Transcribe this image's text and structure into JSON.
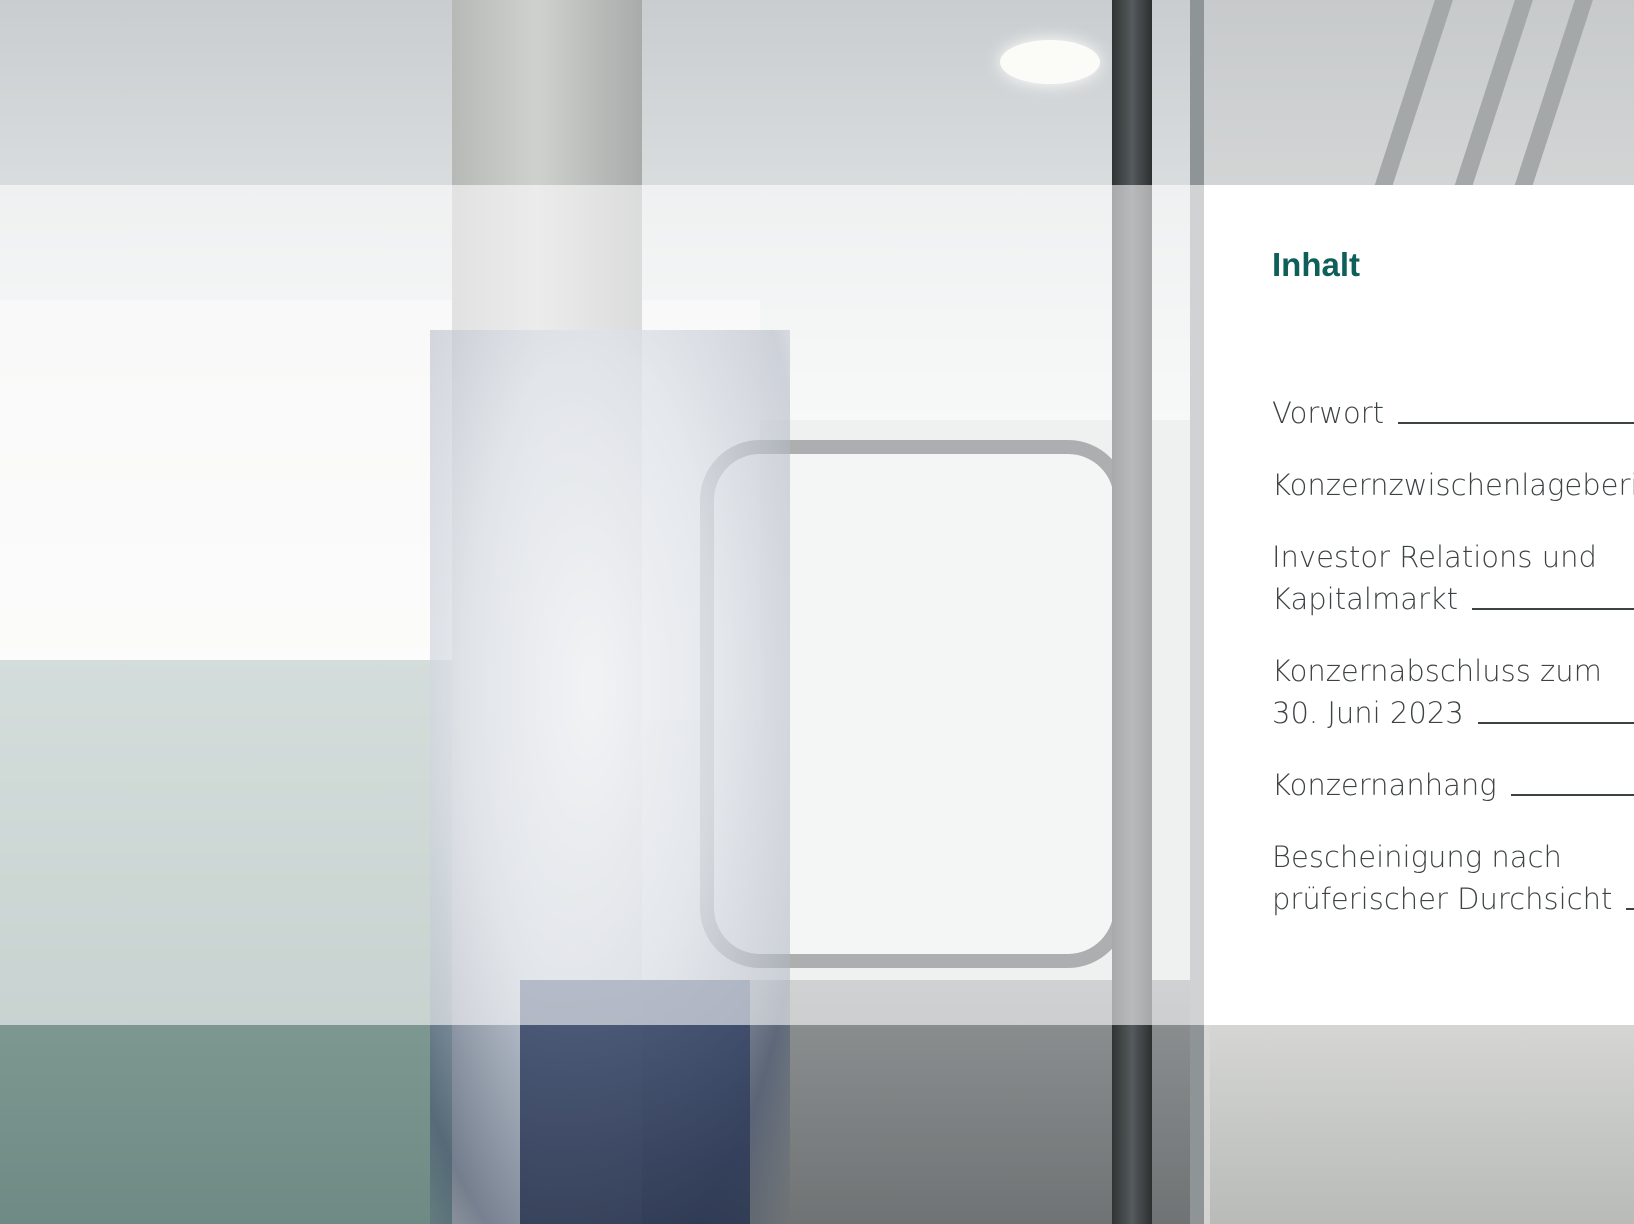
{
  "title": "Inhalt",
  "toc": [
    {
      "lines": [
        "Vorwort"
      ]
    },
    {
      "lines": [
        "Konzernzwischenlageberic"
      ]
    },
    {
      "lines": [
        "Investor Relations und",
        "Kapitalmarkt"
      ]
    },
    {
      "lines": [
        "Konzernabschluss zum",
        "30. Juni 2023"
      ]
    },
    {
      "lines": [
        "Konzernanhang"
      ]
    },
    {
      "lines": [
        "Bescheinigung nach",
        "prüferischer Durchsicht"
      ]
    }
  ],
  "colors": {
    "heading": "#0e5f5a",
    "text": "#3d4244"
  }
}
